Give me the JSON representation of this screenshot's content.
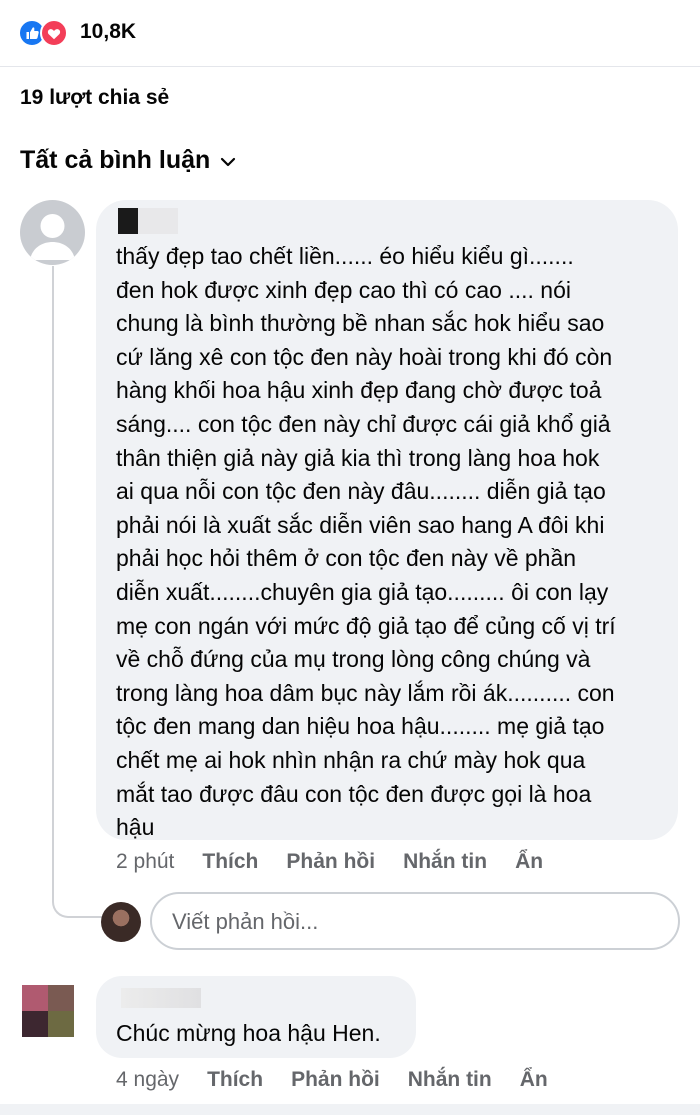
{
  "reactions": {
    "count": "10,8K",
    "icons": [
      "like-icon",
      "love-icon"
    ]
  },
  "shares": "19 lượt chia sẻ",
  "comments_filter": "Tất cả bình luận",
  "comments": [
    {
      "text_lines": [
        "thấy đẹp tao chết liền...... éo hiểu kiểu gì.......",
        "đen hok được xinh đẹp cao thì có cao .... nói",
        "chung là bình thường bề nhan sắc hok hiểu sao",
        "cứ lăng xê con tộc đen này hoài trong khi đó còn",
        "hàng khối hoa hậu xinh đẹp đang chờ được toả",
        "sáng.... con tộc đen này chỉ được cái giả khổ giả",
        "thân thiện giả này giả kia thì trong làng hoa hok",
        "ai qua nỗi con tộc đen này đâu........ diễn giả tạo",
        "phải nói là xuất sắc diễn viên sao hang A đôi khi",
        "phải học hỏi thêm ở con tộc đen này về phần",
        "diễn xuất........chuyên gia giả tạo......... ôi con lạy",
        "mẹ con ngán với mức độ giả tạo để củng cố vị trí",
        "về chỗ đứng của mụ trong lòng công chúng và",
        "trong làng hoa dâm bục này lắm rồi ák.......... con",
        "tộc đen mang dan hiệu  hoa hậu........ mẹ giả tạo",
        "chết mẹ ai hok nhìn nhận ra chứ mày hok qua",
        "mắt tao được đâu con tộc đen được gọi là hoa",
        "hậu"
      ],
      "time": "2 phút",
      "like_label": "Thích",
      "reply_label": "Phản hồi",
      "message_label": "Nhắn tin",
      "hide_label": "Ẩn"
    },
    {
      "text": "Chúc mừng hoa hậu Hen.",
      "time": "4 ngày",
      "like_label": "Thích",
      "reply_label": "Phản hồi",
      "message_label": "Nhắn tin",
      "hide_label": "Ẩn"
    }
  ],
  "reply_input": {
    "placeholder": "Viết phản hồi..."
  },
  "colors": {
    "like": "#1877f2",
    "love": "#f33e58",
    "bubble": "#f0f2f5",
    "secondary_text": "#65676b"
  }
}
